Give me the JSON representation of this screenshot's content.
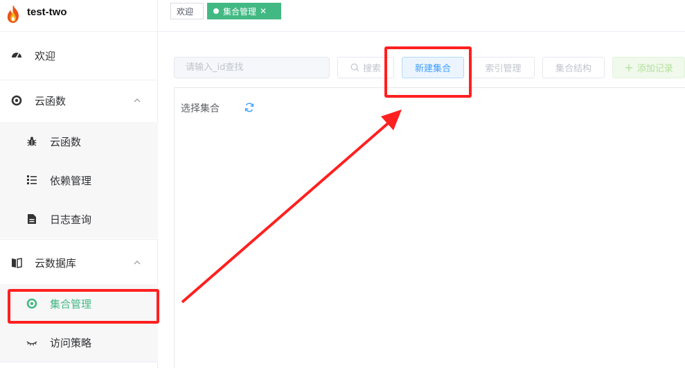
{
  "app": {
    "name": "test-two"
  },
  "tabs": {
    "welcome": "欢迎",
    "active": "集合管理",
    "close_glyph": "✕"
  },
  "sidebar": {
    "welcome": "欢迎",
    "cloud_functions_group": "云函数",
    "cloud_functions_items": [
      "云函数",
      "依赖管理",
      "日志查询"
    ],
    "cloud_db_group": "云数据库",
    "cloud_db_items": [
      "集合管理",
      "访问策略"
    ]
  },
  "toolbar": {
    "search_placeholder": "请输入_id查找",
    "search_label": "搜索",
    "new_collection_label": "新建集合",
    "index_label": "索引管理",
    "structure_label": "集合结构",
    "add_record_label": "添加记录",
    "add_glyph": "+"
  },
  "panel": {
    "select_label": "选择集合"
  },
  "colors": {
    "accent_green": "#42b983",
    "primary_blue": "#409eff",
    "annotation_red": "#ff2020"
  }
}
